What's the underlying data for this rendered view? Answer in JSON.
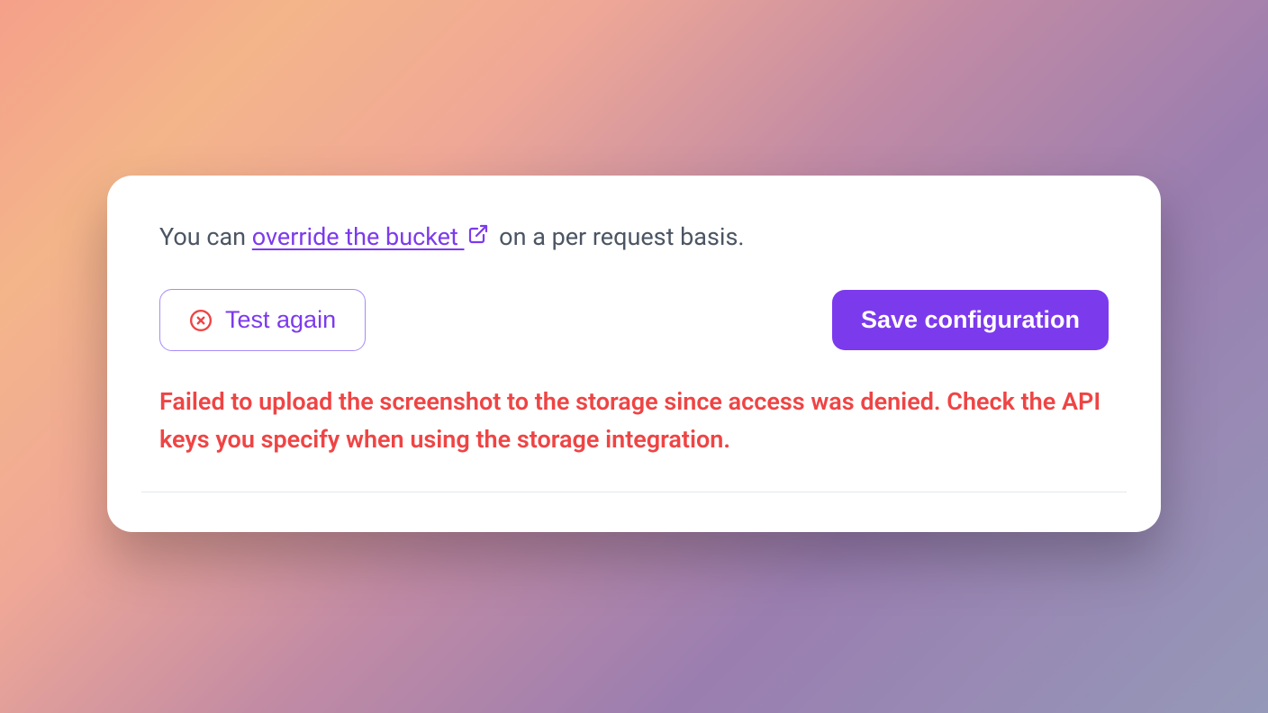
{
  "intro": {
    "prefix": "You can ",
    "link_text": "override the bucket ",
    "suffix": " on a per request basis."
  },
  "buttons": {
    "test_again": "Test again",
    "save_configuration": "Save configuration"
  },
  "error_message": "Failed to upload the screenshot to the storage since access was denied. Check the API keys you specify when using the storage integration.",
  "colors": {
    "accent": "#7c3aed",
    "error": "#ef4444",
    "text_muted": "#4b5563"
  }
}
